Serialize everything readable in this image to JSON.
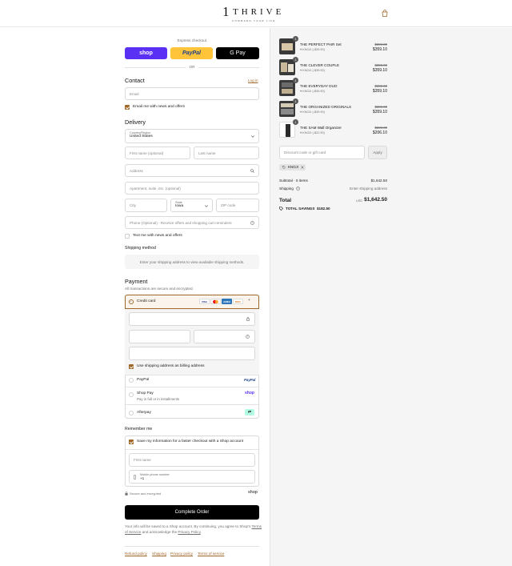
{
  "header": {
    "logo_numeral": "1",
    "logo_word": "THRIVE",
    "logo_tagline": "COMMAND YOUR LIFE",
    "cart_icon": "shopping-bag-icon"
  },
  "express": {
    "label": "Express checkout",
    "shop": "shop",
    "paypal": "PayPal",
    "gpay": "G Pay",
    "or": "OR"
  },
  "contact": {
    "title": "Contact",
    "login": "Log in",
    "email_placeholder": "Email",
    "news_label": "Email me with news and offers",
    "news_checked": true
  },
  "delivery": {
    "title": "Delivery",
    "country_label": "Country/Region",
    "country_value": "United States",
    "first_name": "First name (optional)",
    "last_name": "Last name",
    "address": "Address",
    "apartment": "Apartment, suite, etc. (optional)",
    "city": "City",
    "state_label": "State",
    "state_value": "Iowa",
    "zip": "ZIP code",
    "phone": "Phone (Optional) - Receive offers and shopping cart reminders",
    "text_label": "Text me with news and offers"
  },
  "shipping": {
    "title": "Shipping method",
    "message": "Enter your shipping address to view available shipping methods."
  },
  "payment": {
    "title": "Payment",
    "subtitle": "All transactions are secure and encrypted.",
    "credit_card": "Credit card",
    "card_brands": [
      "VISA",
      "MC",
      "AMEX",
      "DISC"
    ],
    "more": "+",
    "billing_same": "Use shipping address as billing address",
    "paypal": "PayPal",
    "paypal_logo": "PayPal",
    "shoppay": "Shop Pay",
    "shoppay_sub": "Pay in full or in installments",
    "shoppay_logo": "shop",
    "afterpay": "Afterpay",
    "afterpay_logo": "⇄"
  },
  "remember": {
    "title": "Remember me",
    "save_label": "Save my information for a faster checkout with a Shop account",
    "first_name": "First name",
    "mobile_label": "Mobile phone number",
    "mobile_value": "+1",
    "secure": "Secure and encrypted",
    "shop_logo": "shop"
  },
  "complete": {
    "button": "Complete Order",
    "note_pre": "Your info will be saved to a Shop account. By continuing, you agree to Shop's",
    "terms": "Terms of Service",
    "and": "and acknowledge the",
    "privacy": "Privacy Policy",
    "period": "."
  },
  "footer_links": [
    "Refund policy",
    "Shipping",
    "Privacy policy",
    "Terms of service"
  ],
  "summary": {
    "items": [
      {
        "qty": "1",
        "name": "THE PERFECT PAIR Set",
        "discount": "KNOJI (-$39.90)",
        "old": "$399.00",
        "new": "$359.10"
      },
      {
        "qty": "1",
        "name": "THE CLEVER COUPLE",
        "discount": "KNOJI (-$39.90)",
        "old": "$399.00",
        "new": "$359.10"
      },
      {
        "qty": "1",
        "name": "THE EVERYDAY DUO",
        "discount": "KNOJI (-$39.90)",
        "old": "$399.00",
        "new": "$359.10"
      },
      {
        "qty": "1",
        "name": "THE ORGANIZED ORIGINALS",
        "discount": "KNOJI (-$39.90)",
        "old": "$399.00",
        "new": "$359.10"
      },
      {
        "qty": "1",
        "name": "THE SAM Wall Organizer",
        "discount": "KNOJI (-$22.90)",
        "old": "$229.00",
        "new": "$206.10"
      }
    ],
    "code_placeholder": "Discount code or gift card",
    "apply": "Apply",
    "chip": "KNOJI",
    "subtotal_label": "Subtotal · 5 items",
    "subtotal_value": "$1,642.50",
    "shipping_label": "Shipping",
    "shipping_value": "Enter shipping address",
    "total_label": "Total",
    "currency": "USD",
    "total_value": "$1,642.50",
    "savings_label": "TOTAL SAVINGS",
    "savings_value": "$182.50"
  },
  "colors": {
    "accent": "#a0672a",
    "shop": "#5a31f4",
    "paypal": "#ffc439",
    "gpay": "#000000"
  }
}
